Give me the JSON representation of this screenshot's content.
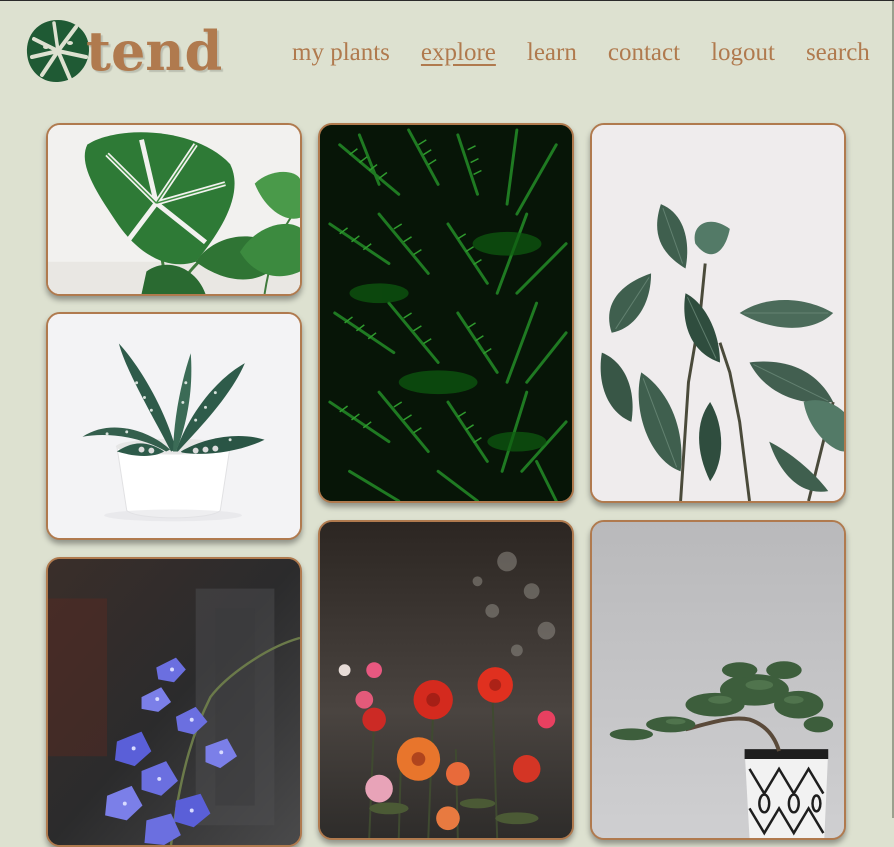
{
  "brand": {
    "name": "tend",
    "logo_icon": "monstera-leaf-icon",
    "leaf_color": "#1f5a34",
    "text_color": "#b07a4e"
  },
  "nav": {
    "items": [
      {
        "label": "my plants",
        "active": false
      },
      {
        "label": "explore",
        "active": true
      },
      {
        "label": "learn",
        "active": false
      },
      {
        "label": "contact",
        "active": false
      },
      {
        "label": "logout",
        "active": false
      },
      {
        "label": "search",
        "active": false
      }
    ]
  },
  "gallery": {
    "cards": [
      {
        "subject": "monstera-plant-photo"
      },
      {
        "subject": "succulent-white-pot-photo"
      },
      {
        "subject": "blue-orchid-photo"
      },
      {
        "subject": "fern-leaves-photo"
      },
      {
        "subject": "red-dahlia-flowers-photo"
      },
      {
        "subject": "rubber-plant-photo"
      },
      {
        "subject": "bonsai-patterned-pot-photo"
      }
    ]
  },
  "colors": {
    "background": "#dde1d0",
    "accent": "#b07a4e"
  }
}
